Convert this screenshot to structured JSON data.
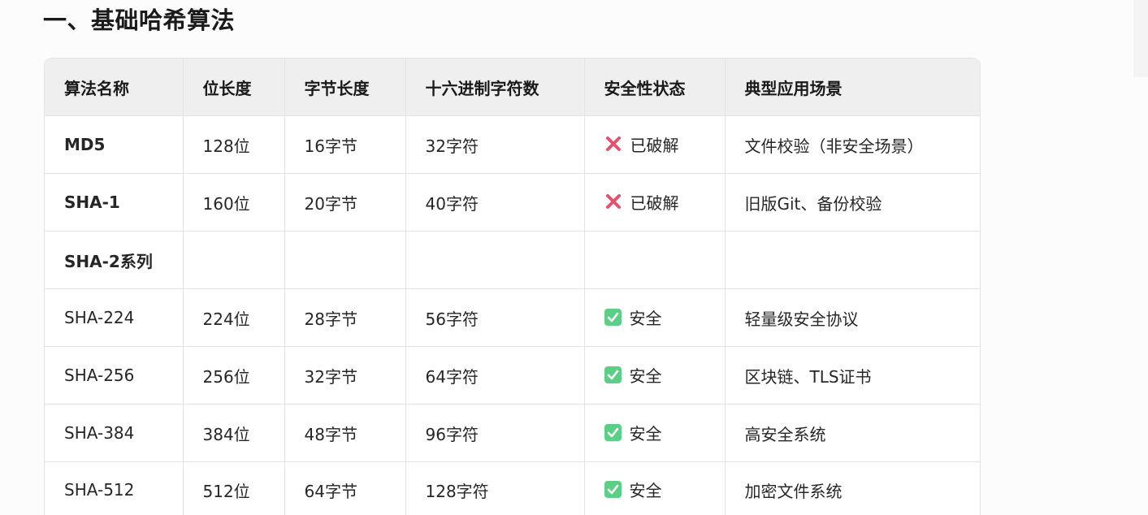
{
  "section": {
    "heading": "一、基础哈希算法"
  },
  "colors": {
    "cracked": "#e2536f",
    "safe": "#5ccf86",
    "header_bg": "#efefef",
    "border": "#e3e3e3"
  },
  "table": {
    "headers": [
      "算法名称",
      "位长度",
      "字节长度",
      "十六进制字符数",
      "安全性状态",
      "典型应用场景"
    ],
    "rows": [
      {
        "name": "MD5",
        "bits": "128位",
        "bytes": "16字节",
        "hex": "32字符",
        "status": "已破解",
        "status_icon": "cross-mark-icon",
        "usage": "文件校验（非安全场景）"
      },
      {
        "name": "SHA-1",
        "bits": "160位",
        "bytes": "20字节",
        "hex": "40字符",
        "status": "已破解",
        "status_icon": "cross-mark-icon",
        "usage": "旧版Git、备份校验"
      },
      {
        "name": "SHA-2系列",
        "bits": "",
        "bytes": "",
        "hex": "",
        "status": "",
        "status_icon": "",
        "usage": ""
      },
      {
        "name": "SHA-224",
        "bits": "224位",
        "bytes": "28字节",
        "hex": "56字符",
        "status": "安全",
        "status_icon": "check-mark-icon",
        "usage": "轻量级安全协议"
      },
      {
        "name": "SHA-256",
        "bits": "256位",
        "bytes": "32字节",
        "hex": "64字符",
        "status": "安全",
        "status_icon": "check-mark-icon",
        "usage": "区块链、TLS证书"
      },
      {
        "name": "SHA-384",
        "bits": "384位",
        "bytes": "48字节",
        "hex": "96字符",
        "status": "安全",
        "status_icon": "check-mark-icon",
        "usage": "高安全系统"
      },
      {
        "name": "SHA-512",
        "bits": "512位",
        "bytes": "64字节",
        "hex": "128字符",
        "status": "安全",
        "status_icon": "check-mark-icon",
        "usage": "加密文件系统"
      }
    ]
  }
}
